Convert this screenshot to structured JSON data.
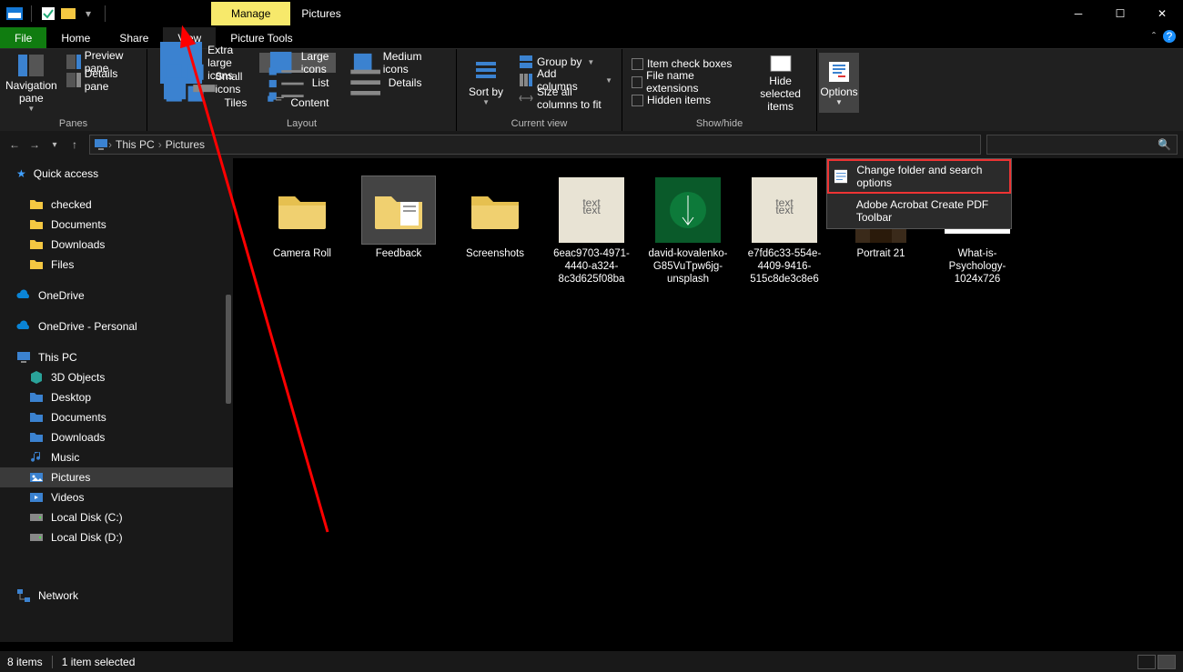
{
  "titlebar": {
    "manage": "Manage",
    "title": "Pictures"
  },
  "tabs": {
    "file": "File",
    "home": "Home",
    "share": "Share",
    "view": "View",
    "picture_tools": "Picture Tools"
  },
  "ribbon": {
    "panes": {
      "navigation_pane": "Navigation pane",
      "preview_pane": "Preview pane",
      "details_pane": "Details pane",
      "group_label": "Panes"
    },
    "layout": {
      "extra_large": "Extra large icons",
      "large": "Large icons",
      "medium": "Medium icons",
      "small": "Small icons",
      "list": "List",
      "details": "Details",
      "tiles": "Tiles",
      "content": "Content",
      "group_label": "Layout"
    },
    "current_view": {
      "sort_by": "Sort by",
      "group_by": "Group by",
      "add_columns": "Add columns",
      "size_all": "Size all columns to fit",
      "group_label": "Current view"
    },
    "show_hide": {
      "item_check": "Item check boxes",
      "file_ext": "File name extensions",
      "hidden": "Hidden items",
      "hide_selected": "Hide selected items",
      "group_label": "Show/hide"
    },
    "options": {
      "label": "Options",
      "change": "Change folder and search options",
      "acrobat": "Adobe Acrobat Create PDF Toolbar"
    }
  },
  "breadcrumb": {
    "pc": "This PC",
    "pictures": "Pictures"
  },
  "sidebar": {
    "quick_access": "Quick access",
    "items1": [
      "checked",
      "Documents",
      "Downloads",
      "Files"
    ],
    "onedrive": "OneDrive",
    "onedrive_personal": "OneDrive - Personal",
    "this_pc": "This PC",
    "pc_items": [
      "3D Objects",
      "Desktop",
      "Documents",
      "Downloads",
      "Music",
      "Pictures",
      "Videos",
      "Local Disk (C:)",
      "Local Disk (D:)"
    ],
    "network": "Network"
  },
  "items": [
    {
      "name": "Camera Roll",
      "type": "folder"
    },
    {
      "name": "Feedback",
      "type": "folder",
      "selected": true
    },
    {
      "name": "Screenshots",
      "type": "folder"
    },
    {
      "name": "6eac9703-4971-4440-a324-8c3d625f08ba",
      "type": "img",
      "bg": "#e8e3d4"
    },
    {
      "name": "david-kovalenko-G85VuTpw6jg-unsplash",
      "type": "img",
      "bg": "#0a5a2a"
    },
    {
      "name": "e7fd6c33-554e-4409-9416-515c8de3c8e6",
      "type": "img",
      "bg": "#e8e3d4"
    },
    {
      "name": "Portrait 21",
      "type": "img",
      "bg": "#7a5a45"
    },
    {
      "name": "What-is-Psychology-1024x726",
      "type": "img",
      "bg": "#fff"
    }
  ],
  "status": {
    "count": "8 items",
    "selected": "1 item selected"
  }
}
